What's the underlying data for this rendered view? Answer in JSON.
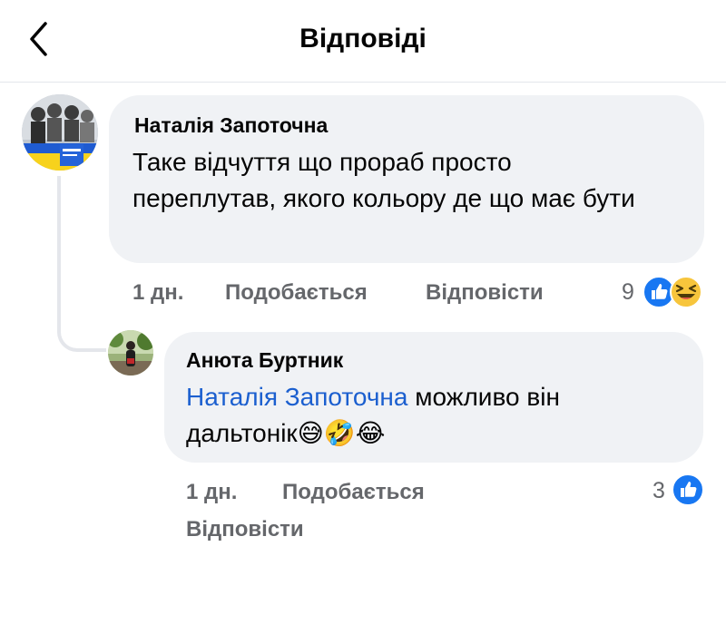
{
  "header": {
    "title": "Відповіді",
    "back_icon": "chevron-left-icon"
  },
  "comments": [
    {
      "author": "Наталія Запоточна",
      "text": "Таке відчуття що прораб просто переплутав, якого кольору де що має бути",
      "time": "1 дн.",
      "like_label": "Подобається",
      "reply_label": "Відповісти",
      "reactions_count": "9",
      "reactions": [
        "like-icon",
        "laugh-emoji-icon"
      ]
    },
    {
      "author": "Анюта Буртник",
      "mention": "Наталія Запоточна",
      "text": "можливо він дальтонік",
      "emojis": [
        "😅",
        "🤣",
        "😂"
      ],
      "time": "1 дн.",
      "like_label": "Подобається",
      "reply_label": "Відповісти",
      "reactions_count": "3",
      "reactions": [
        "like-icon"
      ]
    }
  ],
  "colors": {
    "like_blue": "#1877f2",
    "mention_blue": "#1b5fcf",
    "bubble_bg": "#f0f2f5",
    "meta_gray": "#65676b"
  }
}
